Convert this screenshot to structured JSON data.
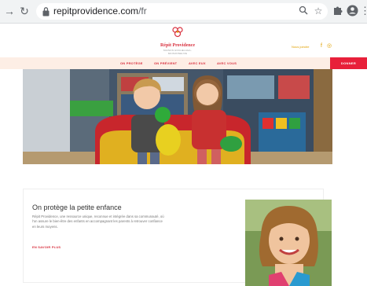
{
  "browser": {
    "url_domain": "repitprovidence.com",
    "url_path": "/fr",
    "icons": {
      "back": "arrow-left-icon",
      "reload": "reload-icon",
      "lock": "lock-icon",
      "search": "search-icon",
      "bookmark": "star-icon",
      "extensions": "puzzle-icon",
      "profile": "account-icon",
      "menu": "more-vert-icon"
    }
  },
  "header": {
    "logo_name": "Répit Providence",
    "logo_tagline": "MAISON HOCHELAGA-MAISONNEUVE",
    "contact_label": "Nous joindre",
    "social": [
      "f",
      "◎"
    ]
  },
  "menu": {
    "items": [
      "ON PROTÈGE",
      "ON PRÉVIENT",
      "AVEC EUX",
      "AVEC VOUS"
    ],
    "donate_label": "DONNER"
  },
  "card": {
    "title": "On protège la petite enfance",
    "text": "Répit Providence, une ressource unique, reconnue et intégrée dans sa communauté, où l'on assure le bien-être des enfants en accompagnant les parents à retrouver confiance en leurs moyens.",
    "link_label": "EN SAVOIR PLUS"
  },
  "colors": {
    "accent": "#d8303e",
    "donate": "#e8203a",
    "menu_bg": "#fdeee5",
    "gold": "#e0a000"
  }
}
